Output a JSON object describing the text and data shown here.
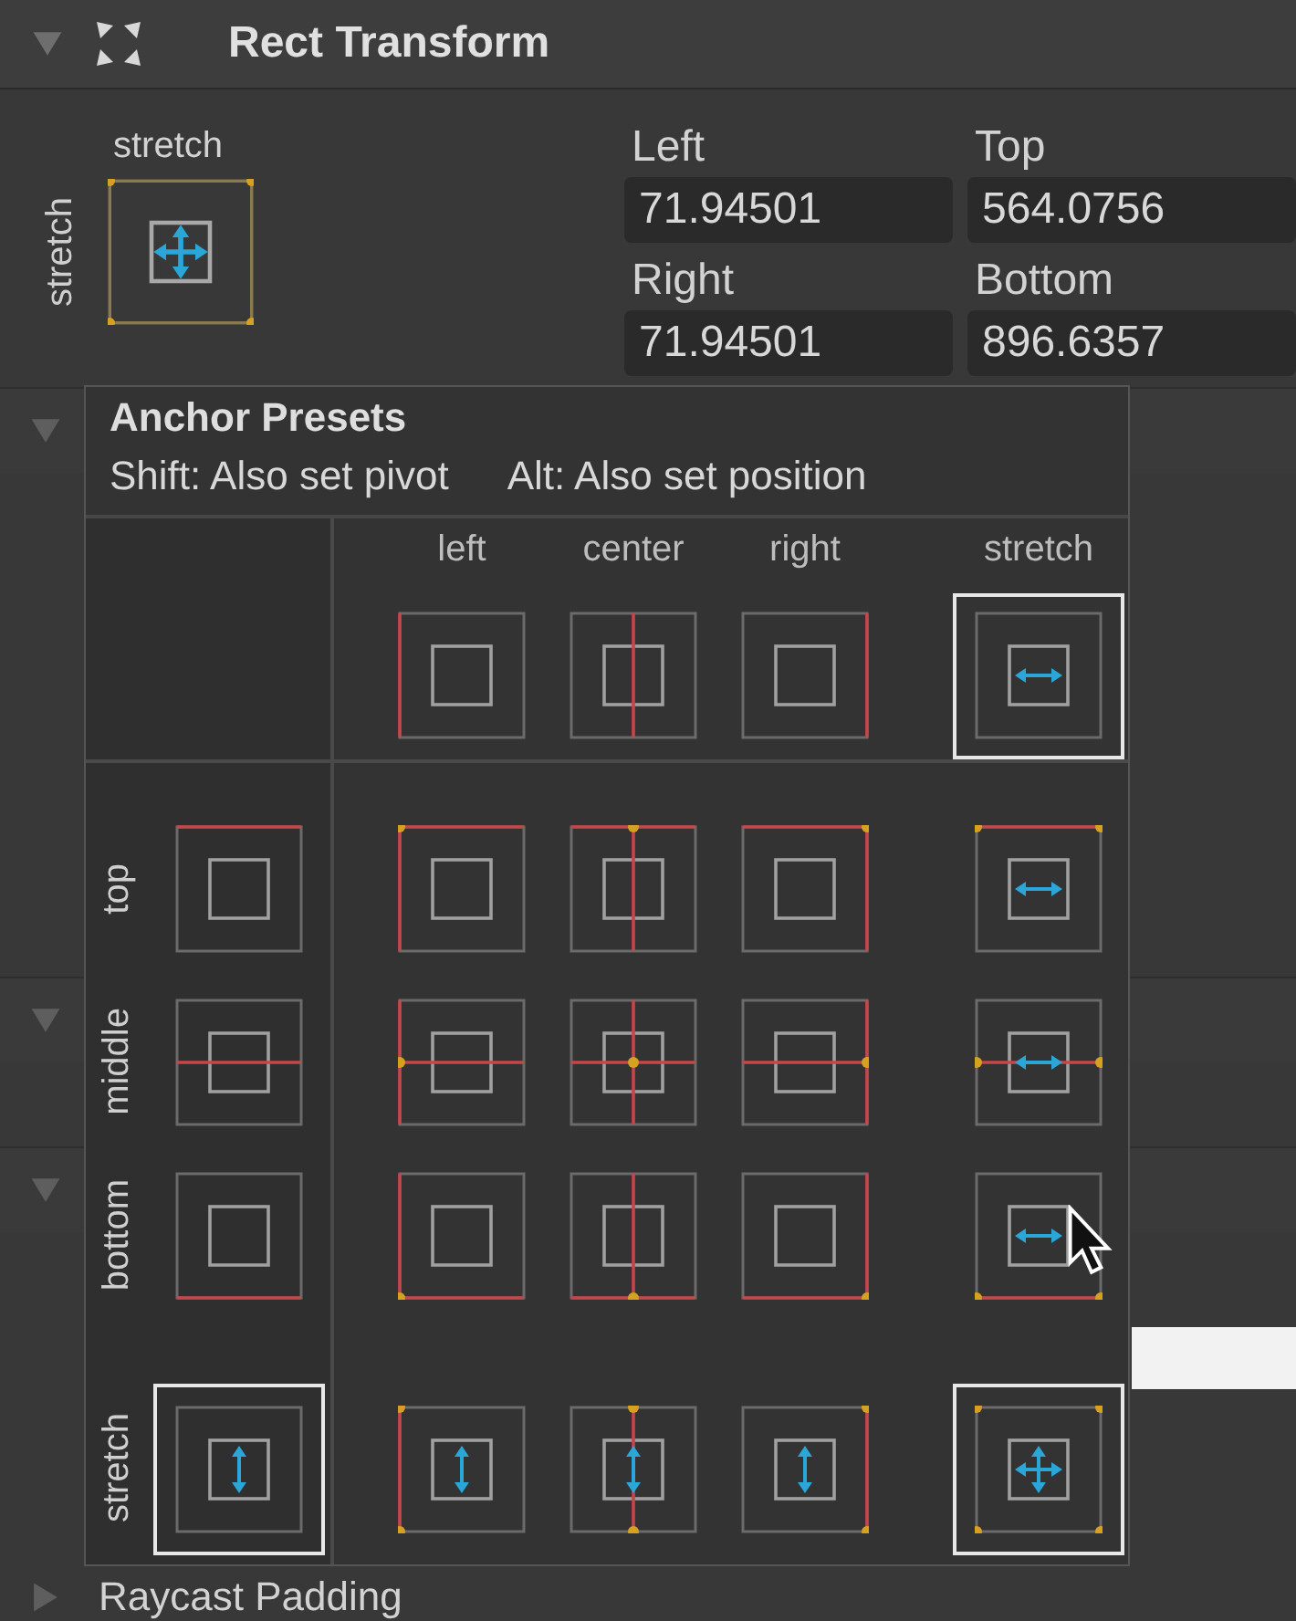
{
  "component": {
    "title": "Rect Transform",
    "expanded": true
  },
  "anchor_widget": {
    "h_label": "stretch",
    "v_label": "stretch",
    "kind": "full_full"
  },
  "fields": [
    {
      "label": "Left",
      "value": "71.94501"
    },
    {
      "label": "Top",
      "value": "564.0756"
    },
    {
      "label": "Right",
      "value": "71.94501"
    },
    {
      "label": "Bottom",
      "value": "896.6357"
    }
  ],
  "background_rows": [
    {
      "kind": "header",
      "expanded": true
    },
    {
      "kind": "field"
    },
    {
      "kind": "field"
    },
    {
      "kind": "field"
    },
    {
      "kind": "field"
    },
    {
      "kind": "field"
    },
    {
      "kind": "plain"
    },
    {
      "kind": "header",
      "expanded": true
    },
    {
      "kind": "field"
    },
    {
      "kind": "header",
      "expanded": true
    },
    {
      "kind": "field"
    },
    {
      "kind": "color_field"
    },
    {
      "kind": "field"
    },
    {
      "kind": "plain"
    }
  ],
  "next_component": {
    "label": "Raycast Padding",
    "expanded": false
  },
  "popup": {
    "title": "Anchor Presets",
    "hints": [
      "Shift: Also set pivot",
      "Alt: Also set position"
    ],
    "columns": [
      {
        "label": "left",
        "kind": "min",
        "selected": false
      },
      {
        "label": "center",
        "kind": "mid",
        "selected": false
      },
      {
        "label": "right",
        "kind": "max",
        "selected": false
      },
      {
        "label": "stretch",
        "kind": "full",
        "selected": true
      }
    ],
    "rows": [
      {
        "label": "top",
        "kind": "min",
        "selected": false,
        "cells": [
          {
            "selected": false
          },
          {
            "selected": false
          },
          {
            "selected": false
          },
          {
            "selected": false
          }
        ]
      },
      {
        "label": "middle",
        "kind": "mid",
        "selected": false,
        "cells": [
          {
            "selected": false
          },
          {
            "selected": false
          },
          {
            "selected": false
          },
          {
            "selected": false
          }
        ]
      },
      {
        "label": "bottom",
        "kind": "max",
        "selected": false,
        "cells": [
          {
            "selected": false
          },
          {
            "selected": false
          },
          {
            "selected": false
          },
          {
            "selected": false
          }
        ]
      },
      {
        "label": "stretch",
        "kind": "full",
        "selected": true,
        "cells": [
          {
            "selected": false
          },
          {
            "selected": false
          },
          {
            "selected": false
          },
          {
            "selected": true
          }
        ]
      }
    ]
  }
}
